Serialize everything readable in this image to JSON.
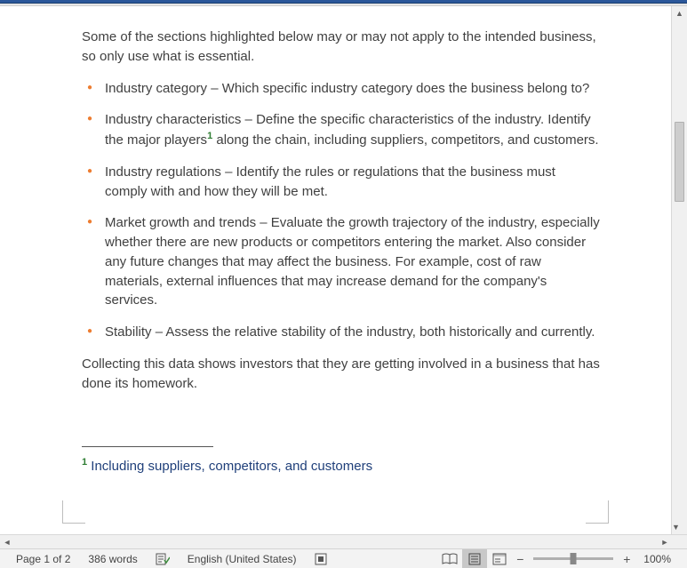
{
  "document": {
    "intro": "Some of the sections highlighted below may or may not apply to the intended business, so only use what is essential.",
    "bullets": [
      {
        "label": "Industry category",
        "text": "Which specific industry category does the business belong to?"
      },
      {
        "label": "Industry characteristics",
        "text_before": "Define the specific characteristics of the industry. Identify the major players",
        "sup": "1",
        "text_after": " along the chain, including suppliers, competitors, and customers."
      },
      {
        "label": "Industry regulations",
        "text": "Identify the rules or regulations that the business must comply with and how they will be met."
      },
      {
        "label": "Market growth and trends",
        "text": "Evaluate the growth trajectory of the industry, especially whether there are new products or competitors entering the market. Also consider any future changes that may affect the business. For example, cost of raw materials, external influences that may increase demand for the company's services."
      },
      {
        "label": "Stability",
        "text": "Assess the relative stability of the industry, both historically and currently."
      }
    ],
    "after": "Collecting this data shows investors that they are getting involved in a business that has done its homework.",
    "footnote": {
      "num": "1",
      "text": " Including suppliers, competitors, and customers"
    }
  },
  "status": {
    "page": "Page 1 of 2",
    "words": "386 words",
    "language": "English (United States)",
    "zoom": "100%"
  }
}
